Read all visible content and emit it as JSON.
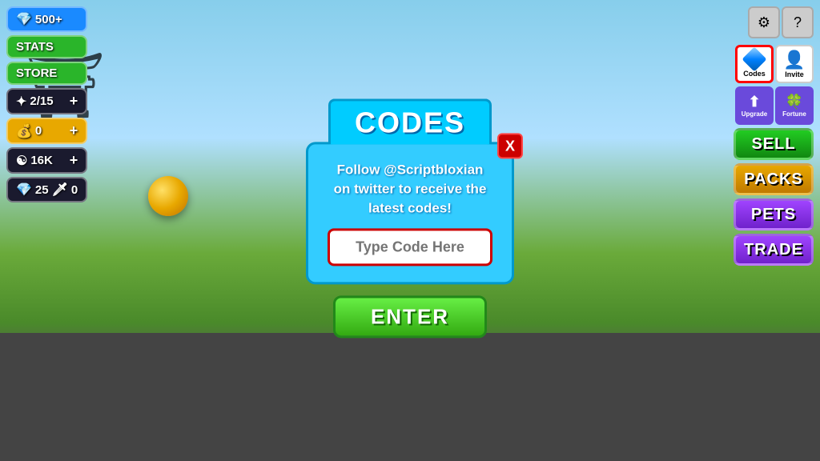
{
  "background": {
    "sky_color": "#87CEEB",
    "road_color": "#444"
  },
  "left_ui": {
    "gem_count": "500+",
    "stats_label": "STATS",
    "store_label": "STORE",
    "inventory": "2/15",
    "coins": "0",
    "yin_yang_count": "16K",
    "sword_count": "0",
    "gems_25": "25"
  },
  "right_ui": {
    "sell_label": "SELL",
    "packs_label": "PACKS",
    "pets_label": "PETS",
    "trade_label": "TRADE",
    "codes_label": "Codes",
    "invite_label": "Invite",
    "upgrade_label": "Upgrade",
    "fortune_label": "Fortune"
  },
  "codes_modal": {
    "title": "CODES",
    "description": "Follow @Scriptbloxian on twitter to receive the latest codes!",
    "input_placeholder": "Type Code Here",
    "enter_label": "ENTER",
    "close_label": "X"
  },
  "arrows": {
    "to_codes_button": true,
    "to_enter_button": true
  }
}
